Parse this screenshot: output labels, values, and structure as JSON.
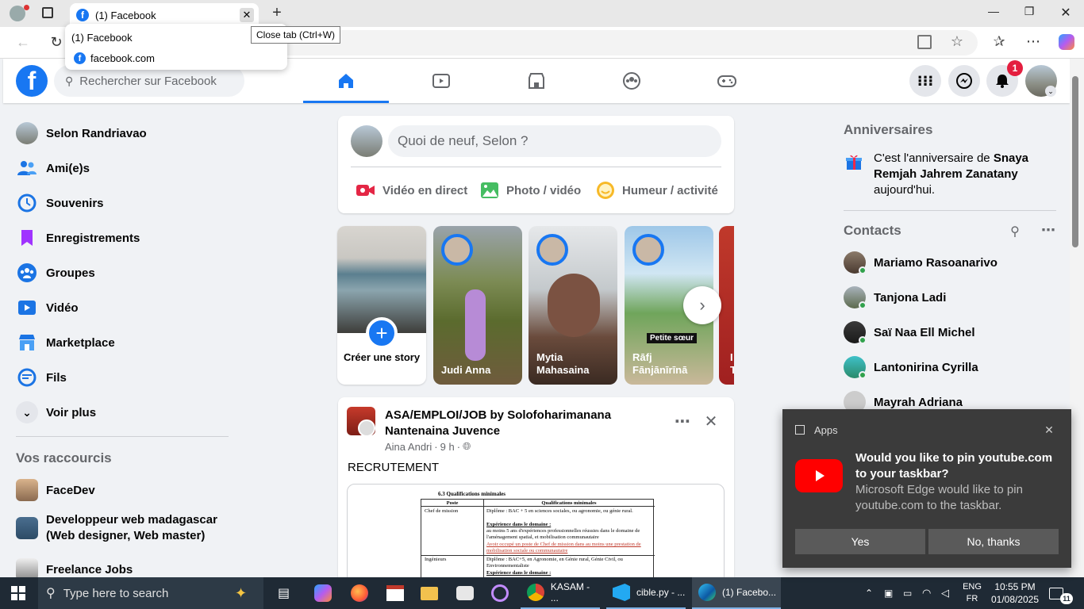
{
  "browser": {
    "tab_title": "(1) Facebook",
    "tab_tooltip": "Close tab (Ctrl+W)",
    "dropdown_title": "(1) Facebook",
    "dropdown_url": "facebook.com"
  },
  "header": {
    "search_placeholder": "Rechercher sur Facebook",
    "notifications_badge": "1",
    "nav_tabs": [
      "home-tab",
      "video-tab",
      "marketplace-tab",
      "groups-tab",
      "gaming-tab"
    ],
    "active_tab": "home-tab",
    "brand_color": "#1877f2"
  },
  "sidebar": {
    "items": [
      {
        "label": "Selon Randriavao",
        "icon": "avatar"
      },
      {
        "label": "Ami(e)s",
        "icon": "friends-icon"
      },
      {
        "label": "Souvenirs",
        "icon": "memories-icon"
      },
      {
        "label": "Enregistrements",
        "icon": "saved-icon"
      },
      {
        "label": "Groupes",
        "icon": "groups-icon"
      },
      {
        "label": "Vidéo",
        "icon": "video-icon"
      },
      {
        "label": "Marketplace",
        "icon": "marketplace-icon"
      },
      {
        "label": "Fils",
        "icon": "feeds-icon"
      },
      {
        "label": "Voir plus",
        "icon": "chevron-down-icon"
      }
    ],
    "shortcuts_title": "Vos raccourcis",
    "shortcuts": [
      {
        "label": "FaceDev"
      },
      {
        "label": "Developpeur web madagascar (Web designer, Web master)"
      },
      {
        "label": "Freelance Jobs"
      }
    ]
  },
  "composer": {
    "placeholder": "Quoi de neuf, Selon ?",
    "live_label": "Vidéo en direct",
    "photo_label": "Photo / vidéo",
    "mood_label": "Humeur / activité"
  },
  "stories": [
    {
      "name": "Créer une story",
      "create": true
    },
    {
      "name": "Judi Anna"
    },
    {
      "name": "Mytia Mahasaina"
    },
    {
      "name": "Rāfj Fānjānīrīnā",
      "caption": "Petite sœur"
    },
    {
      "name": "I T"
    }
  ],
  "post": {
    "page_name": "ASA/EMPLOI/JOB by Solofoharimanana Nantenaina Juvence",
    "author": "Aina Andri",
    "time": "9 h",
    "text": "RECRUTEMENT",
    "doc": {
      "section": "6.3     Qualifications minimales",
      "col1": "Poste",
      "col2": "Qualifications minimales",
      "row1_post": "Chef de mission",
      "row1_text": "Diplôme : BAC + 5 en sciences sociales, ou agronomie, ou génie rural.",
      "row1_exp": "Expérience dans le domaine :",
      "row1_exp_text": "au moins 5 ans d'expériences professionnelles réussies dans le domaine de l'aménagement spatial, et mobilisation communautaire",
      "row1_red": "Avoir occupé un poste de Chef de mission dans au moins une prestation de mobilisation sociale ou communautaire",
      "row2_post": "Ingénieurs",
      "row2_text": "Diplôme : BAC+5, en Agronomie, en Génie rural, Génie Civil, ou Environnementaliste",
      "row2_exp": "Expérience dans le domaine :"
    }
  },
  "right": {
    "birthdays_title": "Anniversaires",
    "birthday_prefix": "C'est l'anniversaire de",
    "birthday_name": "Snaya Remjah Jahrem Zanatany",
    "birthday_suffix": "aujourd'hui.",
    "contacts_title": "Contacts",
    "contacts": [
      {
        "name": "Mariamo Rasoanarivo"
      },
      {
        "name": "Tanjona Ladi"
      },
      {
        "name": "Saï Naa Ell Michel"
      },
      {
        "name": "Lantonirina Cyrilla"
      },
      {
        "name": "Mayrah Adriana"
      }
    ]
  },
  "edge_popup": {
    "app_label": "Apps",
    "title": "Would you like to pin youtube.com to your taskbar?",
    "body": "Microsoft Edge would like to pin youtube.com to the taskbar.",
    "yes": "Yes",
    "no": "No, thanks"
  },
  "taskbar": {
    "search_placeholder": "Type here to search",
    "apps": [
      {
        "label": "KASAM - ..."
      },
      {
        "label": "cible.py - ..."
      },
      {
        "label": "(1) Facebo..."
      }
    ],
    "lang1": "ENG",
    "lang2": "FR",
    "time": "10:55 PM",
    "date": "01/08/2025",
    "notif_count": "11"
  }
}
